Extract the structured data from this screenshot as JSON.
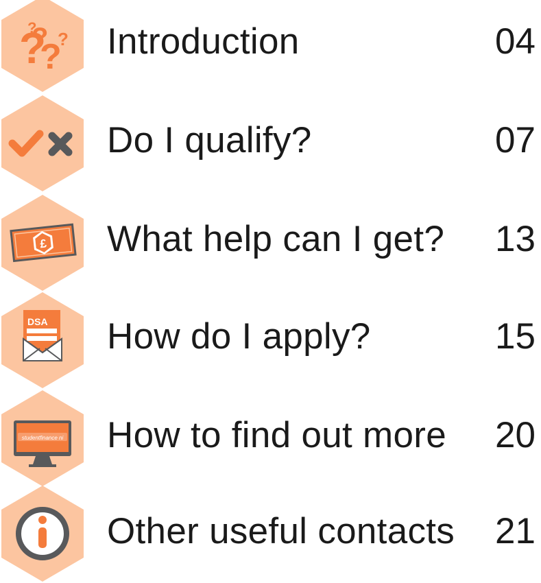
{
  "toc": {
    "items": [
      {
        "title": "Introduction",
        "page": "04",
        "icon": "question-marks-icon"
      },
      {
        "title": "Do I qualify?",
        "page": "07",
        "icon": "tick-cross-icon"
      },
      {
        "title": "What help can I get?",
        "page": "13",
        "icon": "banknote-icon"
      },
      {
        "title": "How do I apply?",
        "page": "15",
        "icon": "envelope-form-icon",
        "icon_text": "DSA"
      },
      {
        "title": "How to find out more",
        "page": "20",
        "icon": "computer-monitor-icon",
        "icon_text": "studentfinance ni"
      },
      {
        "title": "Other useful contacts",
        "page": "21",
        "icon": "info-icon"
      }
    ]
  },
  "colors": {
    "hexagon_fill": "#fcc5a0",
    "accent_orange": "#f47c3c",
    "dark_grey": "#58595b",
    "text": "#1a1a1a"
  }
}
